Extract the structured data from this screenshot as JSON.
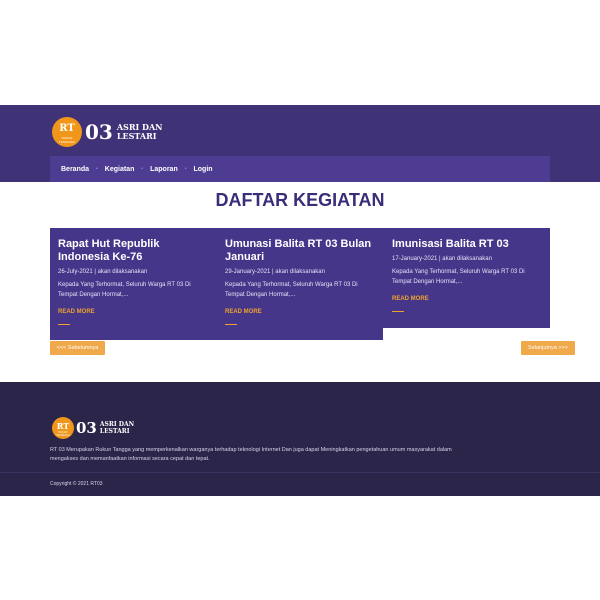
{
  "brand": {
    "logo_short": "RT",
    "logo_sub": "RUKUN TETANGGA",
    "number": "03",
    "name_line1": "ASRI DAN",
    "name_line2": "LESTARI"
  },
  "nav": {
    "items": [
      {
        "label": "Beranda"
      },
      {
        "label": "Kegiatan"
      },
      {
        "label": "Laporan"
      },
      {
        "label": "Login"
      }
    ],
    "separator": "•"
  },
  "main": {
    "title": "DAFTAR KEGIATAN",
    "cards": [
      {
        "title": "Rapat Hut Republik Indonesia Ke-76",
        "meta": "26-July-2021 | akan dilaksanakan",
        "excerpt": "Kepada Yang Terhormat, Seluruh Warga RT 03 Di Tempat Dengan Hormat,...",
        "more": "READ MORE"
      },
      {
        "title": "Umunasi Balita RT 03 Bulan Januari",
        "meta": "29-January-2021 | akan dilaksanakan",
        "excerpt": "Kepada Yang Terhormat, Seluruh Warga RT 03 Di Tempat Dengan Hormat,...",
        "more": "READ MORE"
      },
      {
        "title": "Imunisasi Balita RT 03",
        "meta": "17-January-2021 | akan dilaksanakan",
        "excerpt": "Kepada Yang Terhormat, Seluruh Warga RT 03 Di Tempat Dengan Hormat,...",
        "more": "READ MORE"
      }
    ],
    "prev_label": "<<< Sebelumnya",
    "next_label": "Selanjutnya >>>"
  },
  "footer": {
    "description": "RT 03 Merupakan Rukun Tangga yang memperkenalkan warganya terhadap teknologi Internet Dan juga dapat Meningkatkan pengetahuan umum masyarakat dalam mengakses dan memanfaatkan informasi secara cepat dan tepat.",
    "copyright": "Copyright © 2021 RT03"
  },
  "colors": {
    "primary": "#3f3277",
    "card": "#46368a",
    "accent": "#f0961a",
    "footer": "#2a2549"
  }
}
